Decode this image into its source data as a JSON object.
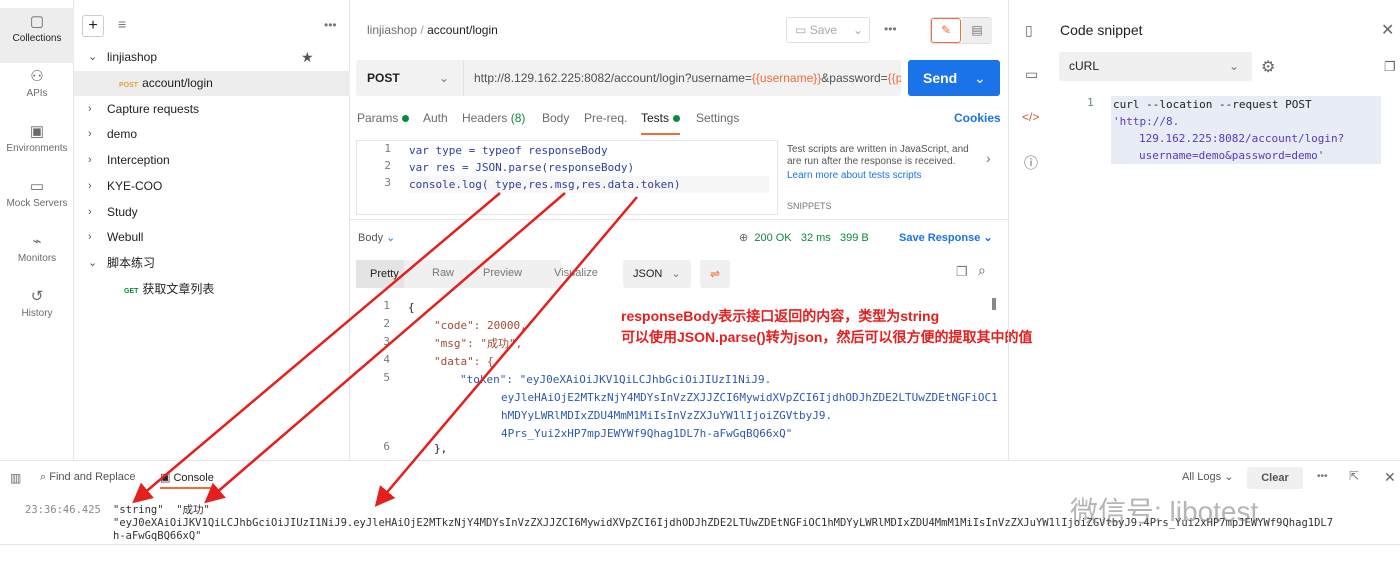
{
  "rail": [
    {
      "label": "Collections",
      "icon": "collections-icon"
    },
    {
      "label": "APIs",
      "icon": "apis-icon"
    },
    {
      "label": "Environments",
      "icon": "environments-icon"
    },
    {
      "label": "Mock Servers",
      "icon": "mock-servers-icon"
    },
    {
      "label": "Monitors",
      "icon": "monitors-icon"
    },
    {
      "label": "History",
      "icon": "history-icon"
    }
  ],
  "sidebar": {
    "items": [
      {
        "label": "linjiashop",
        "expanded": true,
        "starred": true
      },
      {
        "label": "account/login",
        "method": "POST",
        "child": true
      },
      {
        "label": "Capture requests"
      },
      {
        "label": "demo"
      },
      {
        "label": "Interception"
      },
      {
        "label": "KYE-COO"
      },
      {
        "label": "Study"
      },
      {
        "label": "Webull"
      },
      {
        "label": "脚本练习",
        "expanded": true
      },
      {
        "label": "获取文章列表",
        "method": "GET",
        "child": true
      }
    ]
  },
  "header": {
    "collection": "linjiashop",
    "sep": "/",
    "request": "account/login",
    "save": "Save"
  },
  "request": {
    "method": "POST",
    "url_prefix": "http://8.129.162.225:8082/account/login?username=",
    "var1": "{{username}}",
    "url_mid": "&password=",
    "var2": "{{p",
    "send": "Send"
  },
  "tabs": [
    {
      "label": "Params",
      "dot": true
    },
    {
      "label": "Auth"
    },
    {
      "label": "Headers",
      "count": "(8)"
    },
    {
      "label": "Body"
    },
    {
      "label": "Pre-req."
    },
    {
      "label": "Tests",
      "dot": true,
      "active": true
    },
    {
      "label": "Settings"
    }
  ],
  "cookies": "Cookies",
  "tests_code": [
    "var type = typeof responseBody",
    "var res = JSON.parse(responseBody)",
    "console.log( type,res.msg,res.data.token)"
  ],
  "tests_help": {
    "text": "Test scripts are written in JavaScript, and are run after the response is received.",
    "link": "Learn more about tests scripts",
    "snippets": "SNIPPETS"
  },
  "response": {
    "body_label": "Body",
    "status": "200 OK",
    "time": "32 ms",
    "size": "399 B",
    "save": "Save Response",
    "views": [
      "Pretty",
      "Raw",
      "Preview",
      "Visualize"
    ],
    "format": "JSON",
    "lines": [
      "{",
      "\"code\": 20000,",
      "\"msg\": \"成功\",",
      "\"data\": {",
      "\"token\": \"eyJ0eXAiOiJKV1QiLCJhbGciOiJIUzI1NiJ9.",
      "eyJleHAiOjE2MTkzNjY4MDYsInVzZXJJZCI6MywidXVpZCI6IjdhODJhZDE2LTUwZDEtNGFiOC1",
      "hMDYyLWRlMDIxZDU4MmM1MiIsInVzZXJuYW1lIjoiZGVtbyJ9.",
      "4Prs_Yui2xHP7mpJEWYWf9Qhag1DL7h-aFwGqBQ66xQ\"",
      "},"
    ],
    "line_numbers": [
      "1",
      "2",
      "3",
      "4",
      "5",
      "",
      "",
      "",
      "6"
    ]
  },
  "annotation": [
    "responseBody表示接口返回的内容，类型为string",
    "可以使用JSON.parse()转为json，然后可以很方便的提取其中的值"
  ],
  "snippet": {
    "title": "Code snippet",
    "language": "cURL",
    "line": "1",
    "code1": "curl --location --request POST ",
    "code2": "'http://8.",
    "code3": "129.162.225:8082/account/login?",
    "code4": "username=demo&password=demo'"
  },
  "console": {
    "find": "Find and Replace",
    "tab": "Console",
    "all_logs": "All Logs",
    "clear": "Clear",
    "timestamp": "23:36:46.425",
    "out1": "\"string\"  \"成功\"",
    "out2": "\"eyJ0eXAiOiJKV1QiLCJhbGciOiJIUzI1NiJ9.eyJleHAiOjE2MTkzNjY4MDYsInVzZXJJZCI6MywidXVpZCI6IjdhODJhZDE2LTUwZDEtNGFiOC1hMDYyLWRlMDIxZDU4MmM1MiIsInVzZXJuYW1lIjoiZGVtbyJ9.4Prs_Yui2xHP7mpJEWYWf9Qhag1DL7",
    "out3": "h-aFwGqBQ66xQ\""
  },
  "watermark": "微信号: libotest",
  "colors": {
    "accent": "#f26b3a",
    "send": "#1a73e8",
    "annotation": "#e51e1e",
    "status": "#0b8a3a"
  }
}
